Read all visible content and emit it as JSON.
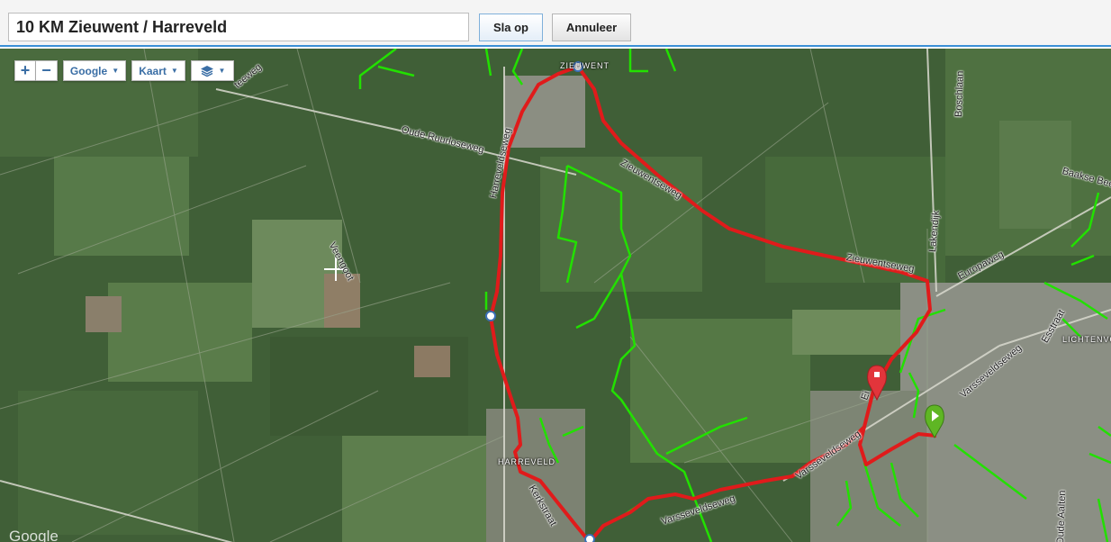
{
  "header": {
    "route_title": "10 KM Zieuwent / Harreveld",
    "save_label": "Sla op",
    "cancel_label": "Annuleer"
  },
  "map_controls": {
    "zoom_in": "+",
    "zoom_out": "−",
    "provider_label": "Google",
    "map_type_label": "Kaart",
    "layers_icon": "layers-icon",
    "caret": "▼"
  },
  "map": {
    "watermark": "Google",
    "places": {
      "zieuwent": "ZIEUWENT",
      "harreveld": "HARREVELD",
      "lichtenvoorde": "LICHTENVO"
    },
    "streets": {
      "oude_ruurloseweg": "Oude Ruurloseweg",
      "harreveldseweg": "Harreveldseweg",
      "zieuwentseweg_1": "Zieuwentseweg",
      "zieuwentseweg_2": "Zieuwentseweg",
      "europaweg": "Europaweg",
      "lakendijk": "Lakendijk",
      "boschlaan": "Boschlaan",
      "varsseveldseweg_1": "Varsseveldseweg",
      "varsseveldseweg_2": "Varsseveldseweg",
      "varsseveldseweg_3": "Varsseveldseweg",
      "esstraat": "Esstraat",
      "baakse_beek": "Baakse Beek",
      "veengoot": "Veengoot",
      "kerkstraat": "Kerkstraat",
      "oude_aalten": "Oude Aalten",
      "eimersweg": "Ei",
      "teeweg": "teeweg"
    },
    "colors": {
      "route": "#e01b1b",
      "trails": "#22e000",
      "start_marker": "#5fb624",
      "end_marker": "#e2353b"
    }
  }
}
